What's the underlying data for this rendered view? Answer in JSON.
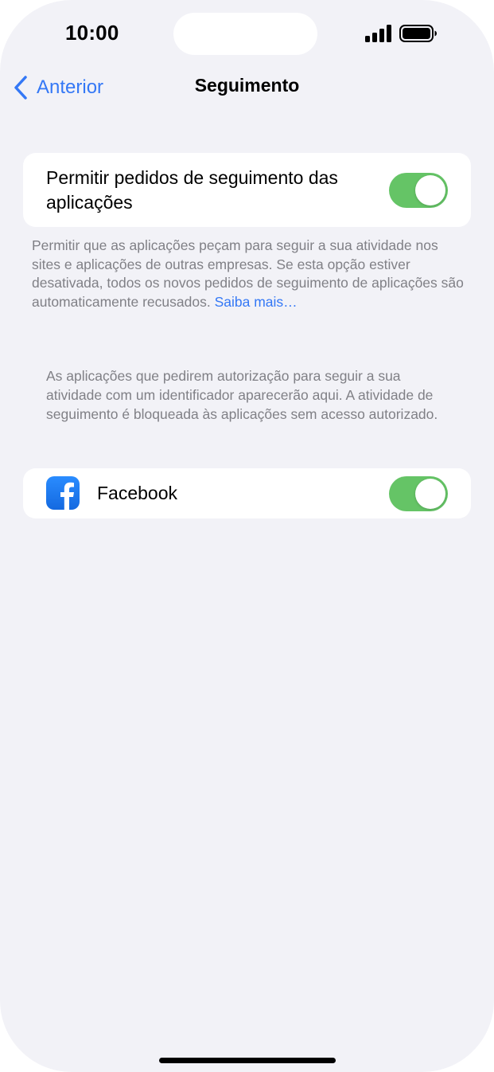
{
  "status_bar": {
    "time": "10:00"
  },
  "nav": {
    "back_label": "Anterior",
    "title": "Seguimento"
  },
  "allow_requests": {
    "label": "Permitir pedidos de seguimento das aplicações",
    "enabled": true
  },
  "footnote": {
    "text": "Permitir que as aplicações peçam para seguir a sua atividade nos sites e aplicações de outras empresas. Se esta opção estiver desativada, todos os novos pedidos de seguimento de aplicações são automaticamente recusados.",
    "learn_more": "Saiba mais…"
  },
  "info_text": "As aplicações que pedirem autorização para seguir a sua atividade com um identificador aparecerão aqui. A atividade de seguimento é bloqueada às aplicações sem acesso autorizado.",
  "apps": [
    {
      "name": "Facebook",
      "icon": "facebook-icon",
      "enabled": true
    }
  ],
  "colors": {
    "background": "#f2f2f7",
    "accent": "#3478f6",
    "toggle_on": "#65c466",
    "secondary_text": "#808086",
    "facebook_blue": "#1877f2"
  }
}
